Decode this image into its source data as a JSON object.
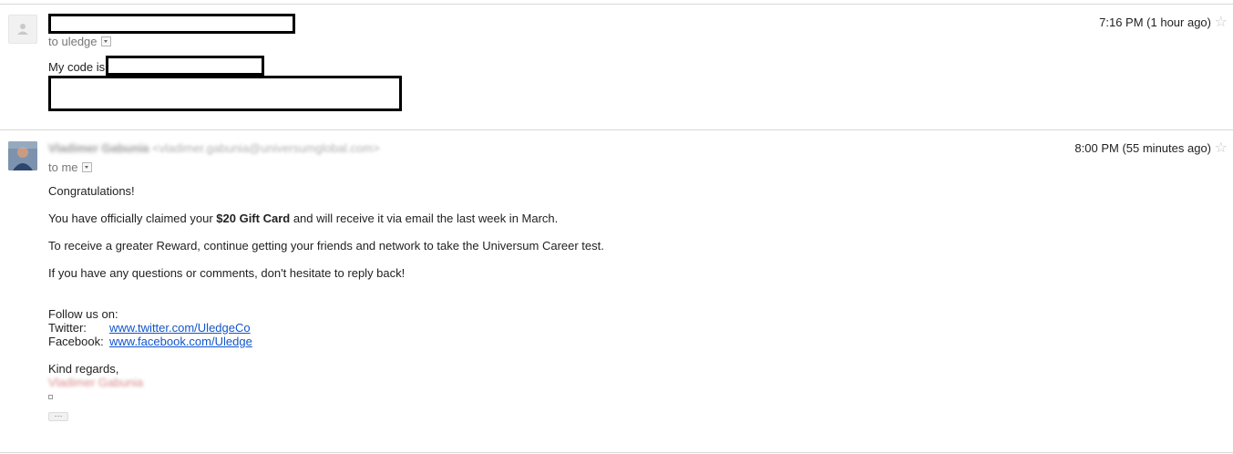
{
  "messages": [
    {
      "recipient_prefix": "to",
      "recipient": "uledge",
      "time": "7:16 PM (1 hour ago)",
      "star": "☆",
      "body_code_prefix": "My code is"
    },
    {
      "sender_name": "Vladimer Gabunia",
      "sender_email": "<vladimer.gabunia@universumglobal.com>",
      "recipient_prefix": "to",
      "recipient": "me",
      "time": "8:00 PM (55 minutes ago)",
      "star": "☆",
      "greeting": "Congratulations!",
      "line1_pre": "You have officially claimed your ",
      "line1_bold": "$20 Gift Card",
      "line1_post": " and will receive it via email the last week in March.",
      "line2": "To receive a greater Reward, continue getting your friends and network to take the Universum Career test.",
      "line3": "If you have any questions or comments, don't hesitate to reply back!",
      "follow_heading": "Follow us on:",
      "twitter_label": "Twitter:",
      "twitter_link": "www.twitter.com/UledgeCo",
      "facebook_label": "Facebook:",
      "facebook_link": "www.facebook.com/Uledge",
      "closing": "Kind regards,",
      "signature_name": "Vladimer Gabunia",
      "more_button": "···"
    }
  ]
}
